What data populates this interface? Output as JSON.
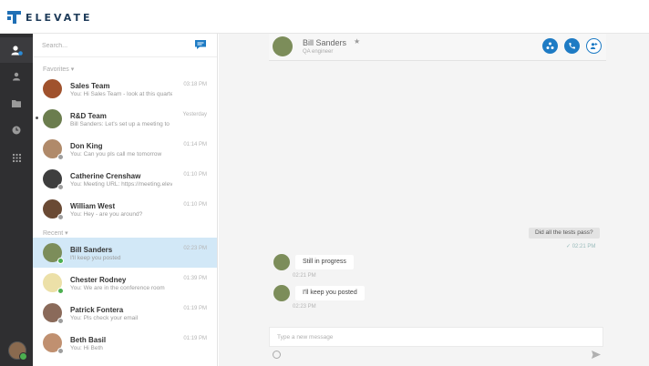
{
  "app": {
    "logo_text": "ELEVATE"
  },
  "search": {
    "placeholder": "Search..."
  },
  "sections": {
    "favorites": "Favorites",
    "recent": "Recent"
  },
  "favorites": [
    {
      "name": "Sales Team",
      "preview": "You: Hi Sales Team - look at this quarterly",
      "time": "03:18 PM",
      "avatar_color": "#a0522d",
      "presence": ""
    },
    {
      "name": "R&D Team",
      "preview": "Bill Sanders: Let's set up a meeting to",
      "time": "Yesterday",
      "avatar_color": "#6b7d4e",
      "presence": ""
    },
    {
      "name": "Don King",
      "preview": "You: Can you pls call me tomorrow",
      "time": "01:14 PM",
      "avatar_color": "#b08a6a",
      "presence": "#9e9e9e"
    },
    {
      "name": "Catherine Crenshaw",
      "preview": "You: Meeting URL: https://meeting.elevate",
      "time": "01:10 PM",
      "avatar_color": "#3e3e3e",
      "presence": "#9e9e9e"
    },
    {
      "name": "William West",
      "preview": "You: Hey - are you around?",
      "time": "01:10 PM",
      "avatar_color": "#6a4a34",
      "presence": "#9e9e9e"
    }
  ],
  "recent": [
    {
      "name": "Bill Sanders",
      "preview": "I'll keep you posted",
      "time": "02:23 PM",
      "avatar_color": "#7c8d5a",
      "presence": "#4caf50",
      "selected": true
    },
    {
      "name": "Chester Rodney",
      "preview": "You: We are in the conference room",
      "time": "01:39 PM",
      "avatar_color": "#ece0a8",
      "presence": "#4caf50"
    },
    {
      "name": "Patrick Fontera",
      "preview": "You: Pls check your email",
      "time": "01:19 PM",
      "avatar_color": "#8a6a5a",
      "presence": "#9e9e9e"
    },
    {
      "name": "Beth Basil",
      "preview": "You: Hi Beth",
      "time": "01:19 PM",
      "avatar_color": "#c09070",
      "presence": "#9e9e9e"
    }
  ],
  "conversation": {
    "contact_name": "Bill Sanders",
    "contact_role": "QA engineer",
    "messages": {
      "outgoing": {
        "text": "Did all the tests pass?",
        "status": "02:21 PM"
      },
      "incoming": [
        {
          "text": "Still in progress",
          "time": "02:21 PM"
        },
        {
          "text": "I'll keep you posted",
          "time": "02:23 PM"
        }
      ]
    },
    "composer_placeholder": "Type a new message"
  },
  "colors": {
    "accent": "#1e7bc4",
    "rail": "#2f2f31",
    "selected_row": "#d2e8f7",
    "online": "#4caf50"
  },
  "icons": {
    "rail": [
      "contacts-icon",
      "person-icon",
      "folder-icon",
      "clock-icon",
      "grid-icon"
    ],
    "header_actions": [
      "screen-share-icon",
      "phone-icon",
      "add-user-icon"
    ]
  }
}
